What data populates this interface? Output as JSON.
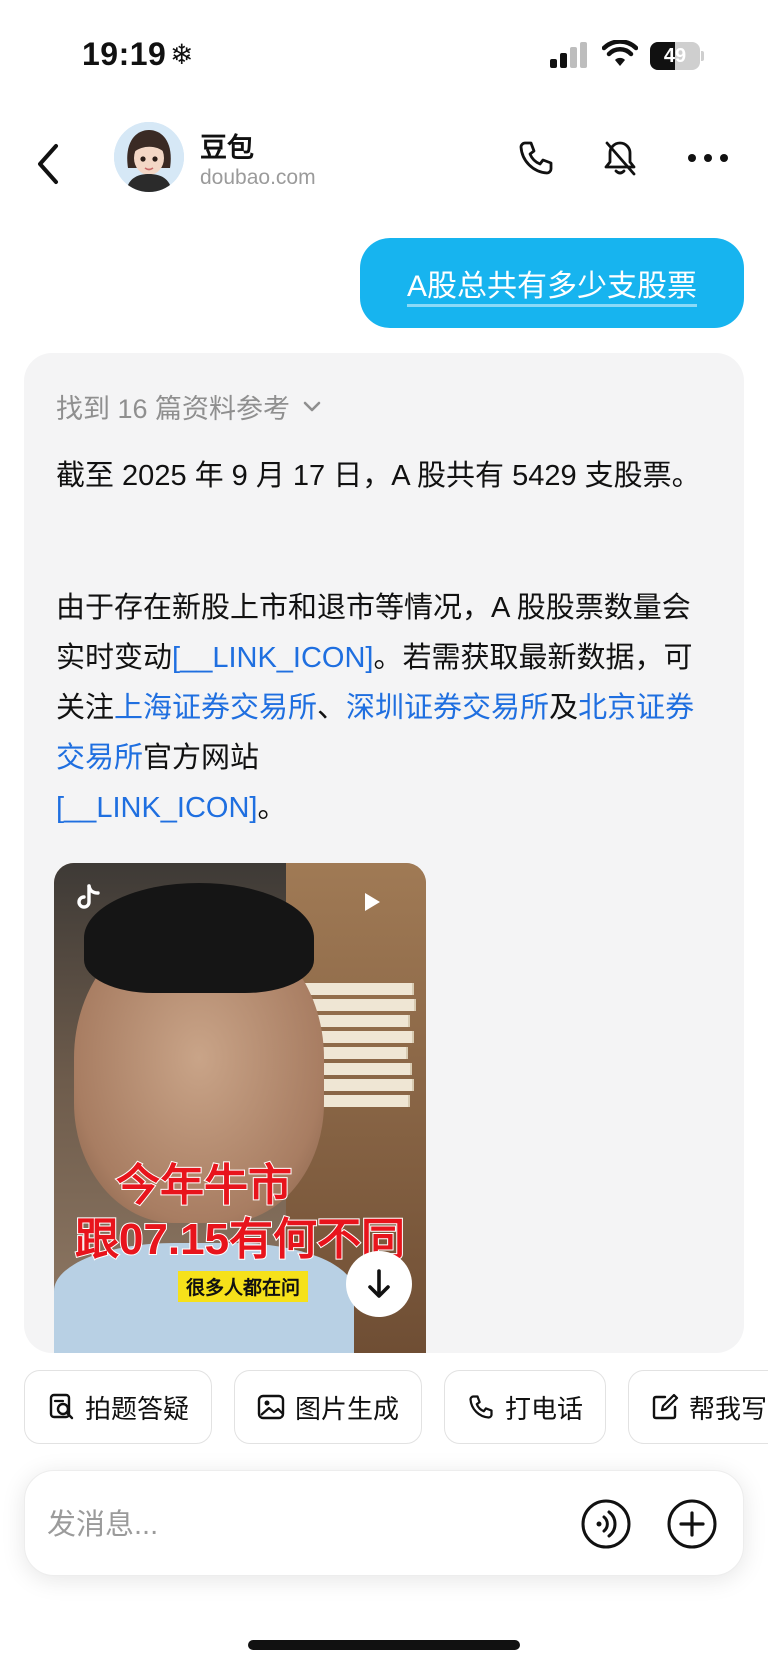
{
  "status_bar": {
    "time": "19:19",
    "weather_glyph": "❄",
    "battery": "49",
    "battery_level_percent": 49
  },
  "header": {
    "name": "豆包",
    "domain": "doubao.com",
    "icons": [
      "back-icon",
      "phone-icon",
      "mute-icon",
      "more-icon"
    ]
  },
  "user_message": "A股总共有多少支股票",
  "answer": {
    "refs_label": "找到 16 篇资料参考",
    "p1": "截至 2025 年 9 月 17 日，A 股共有 5429 支股票。",
    "p2_a": "由于存在新股上市和退市等情况，A 股股票数量会实时变动",
    "link_icon_1": "[__LINK_ICON]",
    "p2_b": "。若需获取最新数据，可关注",
    "link_sse": "上海证券交易所",
    "sep": "、",
    "link_szse": "深圳证券交易所",
    "p2_c": "及",
    "link_bse": "北京证券交易所",
    "p2_d": "官方网站",
    "link_icon_2": "[__LINK_ICON]",
    "p2_end": "。"
  },
  "video": {
    "caption_line1": "今年牛市",
    "caption_line2": "跟07.15有何不同",
    "caption_tag": "很多人都在问"
  },
  "quick_actions": [
    {
      "label": "拍题答疑",
      "icon": "photo-question-icon"
    },
    {
      "label": "图片生成",
      "icon": "image-icon"
    },
    {
      "label": "打电话",
      "icon": "phone-icon"
    },
    {
      "label": "帮我写",
      "icon": "edit-icon"
    }
  ],
  "input": {
    "placeholder": "发消息..."
  },
  "colors": {
    "accent": "#17b4ef",
    "link": "#1f6fe0",
    "card_bg": "#f4f4f5"
  }
}
